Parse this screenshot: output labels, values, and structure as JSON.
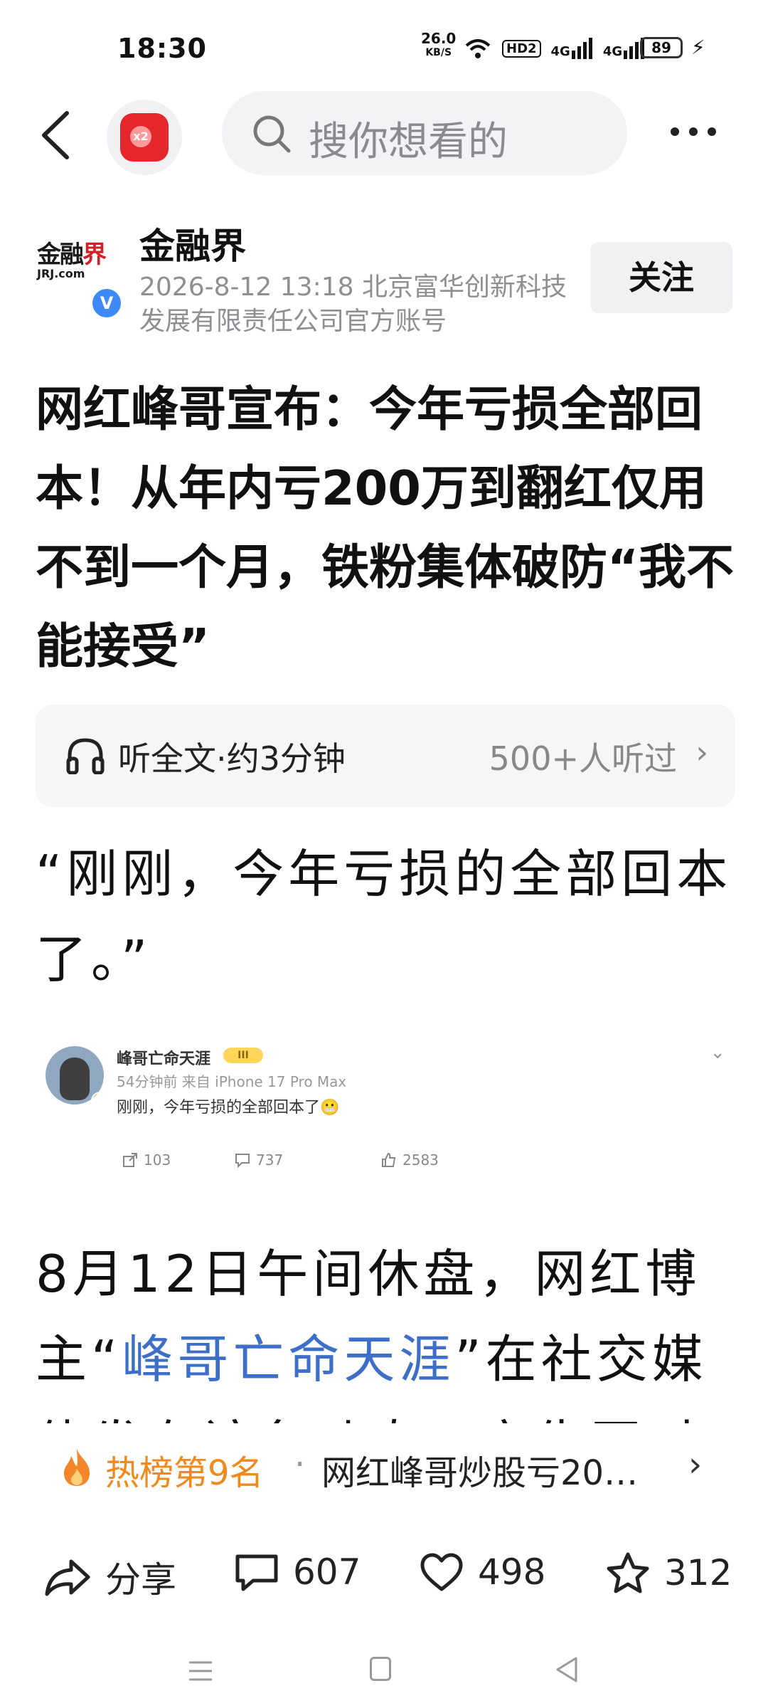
{
  "status_bar": {
    "time": "18:30",
    "net_speed_value": "26.0",
    "net_speed_unit": "KB/S",
    "hd_label": "HD2",
    "signal1_label": "4G",
    "signal2_label": "4G",
    "battery": "89"
  },
  "nav": {
    "search_placeholder": "搜你想看的",
    "redpacket_badge": "x2"
  },
  "author": {
    "logo_text_main": "金融界",
    "logo_text_sub": "JRJ.com",
    "verified_mark": "V",
    "name": "金融界",
    "meta_line1": "2026-8-12  13:18  北京富华创新科技",
    "meta_line2": "发展有限责任公司官方账号",
    "follow_label": "关注"
  },
  "article": {
    "title": "网红峰哥宣布：今年亏损全部回本！从年内亏200万到翻红仅用不到一个月，铁粉集体破防“我不能接受”",
    "listen_label": "听全文·约3分钟",
    "listen_count": "500+人听过",
    "quote": "“刚刚，今年亏损的全部回本了。”",
    "para_prefix": "8月12日午间休盘，网红博主“",
    "para_link": "峰哥亡命天涯",
    "para_suffix": "”在社交媒体发布该条动态，宣告同时数月的"
  },
  "embed": {
    "name": "峰哥亡命天涯",
    "rank_badge": "III",
    "meta": "54分钟前 来自 iPhone 17 Pro Max",
    "text": "刚刚，今年亏损的全部回本了😬",
    "reposts": "103",
    "comments": "737",
    "likes": "2583"
  },
  "hot": {
    "rank": "热榜第9名",
    "dot": "·",
    "title": "网红峰哥炒股亏20…"
  },
  "actions": {
    "share_label": "分享",
    "comments": "607",
    "likes": "498",
    "favorites": "312"
  },
  "colors": {
    "accent_link": "#3e6fc8",
    "hot_orange": "#f08a1d",
    "verified_blue": "#3d8af7",
    "redpacket": "#e5262c"
  }
}
